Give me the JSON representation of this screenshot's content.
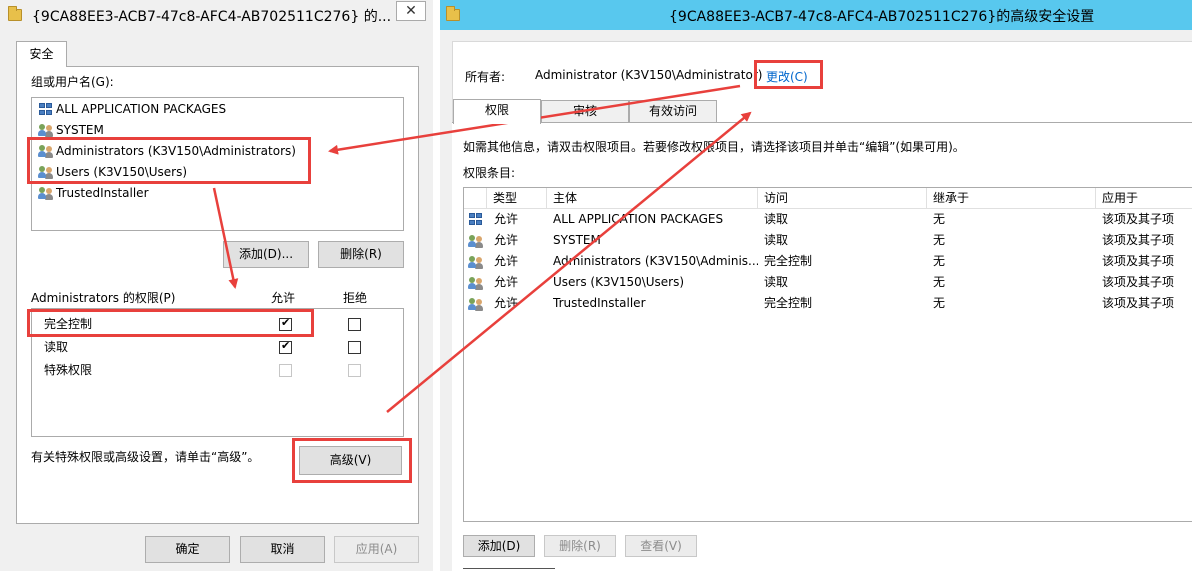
{
  "left_dialog": {
    "title": "{9CA88EE3-ACB7-47c8-AFC4-AB702511C276} 的...",
    "close_label": "✕",
    "tab_label": "安全",
    "group_label": "组或用户名(G):",
    "groups": [
      {
        "icon": "package-icon",
        "name": "ALL APPLICATION PACKAGES"
      },
      {
        "icon": "users-icon",
        "name": "SYSTEM"
      },
      {
        "icon": "users-icon",
        "name": "Administrators (K3V150\\Administrators)"
      },
      {
        "icon": "users-icon",
        "name": "Users (K3V150\\Users)"
      },
      {
        "icon": "users-icon",
        "name": "TrustedInstaller"
      }
    ],
    "add_button": "添加(D)...",
    "remove_button": "删除(R)",
    "perm_label": "Administrators 的权限(P)",
    "allow_header": "允许",
    "deny_header": "拒绝",
    "permissions": [
      {
        "name": "完全控制",
        "allow": true,
        "deny": false,
        "enabled": true
      },
      {
        "name": "读取",
        "allow": true,
        "deny": false,
        "enabled": true
      },
      {
        "name": "特殊权限",
        "allow": false,
        "deny": false,
        "enabled": false
      }
    ],
    "advanced_hint": "有关特殊权限或高级设置，请单击“高级”。",
    "advanced_button": "高级(V)",
    "ok_button": "确定",
    "cancel_button": "取消",
    "apply_button": "应用(A)"
  },
  "right_window": {
    "title": "{9CA88EE3-ACB7-47c8-AFC4-AB702511C276}的高级安全设置",
    "owner_label": "所有者:",
    "owner_value": "Administrator (K3V150\\Administrator)",
    "change_link": "更改(C)",
    "tabs": [
      "权限",
      "审核",
      "有效访问"
    ],
    "info_text": "如需其他信息，请双击权限项目。若要修改权限项目，请选择该项目并单击“编辑”(如果可用)。",
    "entries_label": "权限条目:",
    "columns": [
      "类型",
      "主体",
      "访问",
      "继承于",
      "应用于"
    ],
    "rows": [
      {
        "icon": "package-icon",
        "type": "允许",
        "principal": "ALL APPLICATION PACKAGES",
        "access": "读取",
        "inherited": "无",
        "applies": "该项及其子项"
      },
      {
        "icon": "users-icon",
        "type": "允许",
        "principal": "SYSTEM",
        "access": "读取",
        "inherited": "无",
        "applies": "该项及其子项"
      },
      {
        "icon": "users-icon",
        "type": "允许",
        "principal": "Administrators (K3V150\\Adminis...",
        "access": "完全控制",
        "inherited": "无",
        "applies": "该项及其子项"
      },
      {
        "icon": "users-icon",
        "type": "允许",
        "principal": "Users (K3V150\\Users)",
        "access": "读取",
        "inherited": "无",
        "applies": "该项及其子项"
      },
      {
        "icon": "users-icon",
        "type": "允许",
        "principal": "TrustedInstaller",
        "access": "完全控制",
        "inherited": "无",
        "applies": "该项及其子项"
      }
    ],
    "add_button": "添加(D)",
    "remove_button": "删除(R)",
    "view_button": "查看(V)"
  },
  "colors": {
    "annotation_red": "#e8403c",
    "title_bar_blue": "#58c8ee",
    "link_blue": "#0066cc"
  }
}
